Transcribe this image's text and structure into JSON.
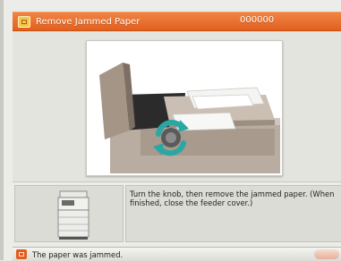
{
  "title_bar": {
    "title": "Remove Jammed Paper",
    "code": "000000"
  },
  "message": {
    "instruction": "Turn the knob, then remove the jammed paper. (When finished, close the feeder cover.)"
  },
  "status_bar": {
    "text": "The paper was jammed."
  },
  "colors": {
    "accent": "#e2601f",
    "rotate_arrow": "#2aa7a4"
  },
  "icons": {
    "title": "paper-jam-icon",
    "status": "paper-jam-icon",
    "illustration_arrow": "rotate-arrow-icon"
  }
}
